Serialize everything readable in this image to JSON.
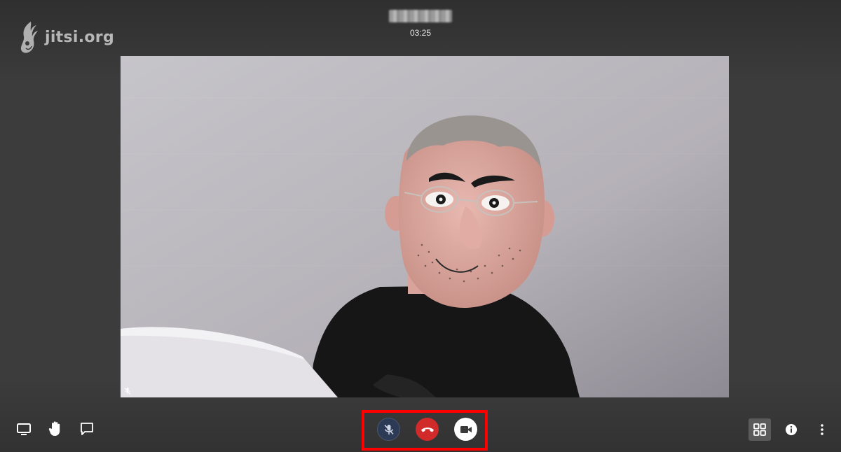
{
  "app": {
    "logo_text": "jitsi.org"
  },
  "header": {
    "timer": "03:25"
  },
  "toolbar": {
    "left": [
      {
        "icon": "screen-share-icon"
      },
      {
        "icon": "raise-hand-icon"
      },
      {
        "icon": "chat-icon"
      }
    ],
    "center": [
      {
        "icon": "microphone-muted-icon",
        "state": "muted"
      },
      {
        "icon": "hangup-icon",
        "color": "#d12a2a"
      },
      {
        "icon": "video-camera-icon",
        "state": "on"
      }
    ],
    "right": [
      {
        "icon": "tile-view-icon",
        "active": true
      },
      {
        "icon": "info-icon"
      },
      {
        "icon": "more-options-icon"
      }
    ]
  },
  "colors": {
    "highlight_border": "#ff0000",
    "hangup": "#d12a2a",
    "mic_button": "#2c3a55"
  }
}
